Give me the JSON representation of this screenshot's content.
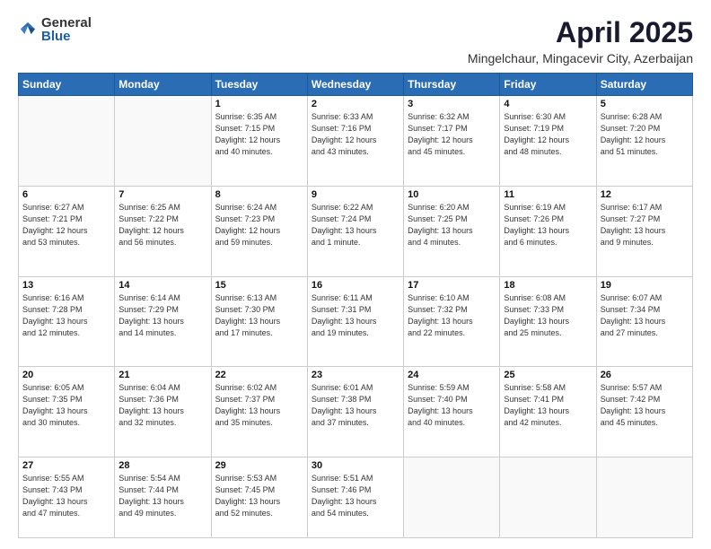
{
  "logo": {
    "general": "General",
    "blue": "Blue"
  },
  "header": {
    "month": "April 2025",
    "location": "Mingelchaur, Mingacevir City, Azerbaijan"
  },
  "days_of_week": [
    "Sunday",
    "Monday",
    "Tuesday",
    "Wednesday",
    "Thursday",
    "Friday",
    "Saturday"
  ],
  "weeks": [
    [
      {
        "day": "",
        "info": ""
      },
      {
        "day": "",
        "info": ""
      },
      {
        "day": "1",
        "info": "Sunrise: 6:35 AM\nSunset: 7:15 PM\nDaylight: 12 hours\nand 40 minutes."
      },
      {
        "day": "2",
        "info": "Sunrise: 6:33 AM\nSunset: 7:16 PM\nDaylight: 12 hours\nand 43 minutes."
      },
      {
        "day": "3",
        "info": "Sunrise: 6:32 AM\nSunset: 7:17 PM\nDaylight: 12 hours\nand 45 minutes."
      },
      {
        "day": "4",
        "info": "Sunrise: 6:30 AM\nSunset: 7:19 PM\nDaylight: 12 hours\nand 48 minutes."
      },
      {
        "day": "5",
        "info": "Sunrise: 6:28 AM\nSunset: 7:20 PM\nDaylight: 12 hours\nand 51 minutes."
      }
    ],
    [
      {
        "day": "6",
        "info": "Sunrise: 6:27 AM\nSunset: 7:21 PM\nDaylight: 12 hours\nand 53 minutes."
      },
      {
        "day": "7",
        "info": "Sunrise: 6:25 AM\nSunset: 7:22 PM\nDaylight: 12 hours\nand 56 minutes."
      },
      {
        "day": "8",
        "info": "Sunrise: 6:24 AM\nSunset: 7:23 PM\nDaylight: 12 hours\nand 59 minutes."
      },
      {
        "day": "9",
        "info": "Sunrise: 6:22 AM\nSunset: 7:24 PM\nDaylight: 13 hours\nand 1 minute."
      },
      {
        "day": "10",
        "info": "Sunrise: 6:20 AM\nSunset: 7:25 PM\nDaylight: 13 hours\nand 4 minutes."
      },
      {
        "day": "11",
        "info": "Sunrise: 6:19 AM\nSunset: 7:26 PM\nDaylight: 13 hours\nand 6 minutes."
      },
      {
        "day": "12",
        "info": "Sunrise: 6:17 AM\nSunset: 7:27 PM\nDaylight: 13 hours\nand 9 minutes."
      }
    ],
    [
      {
        "day": "13",
        "info": "Sunrise: 6:16 AM\nSunset: 7:28 PM\nDaylight: 13 hours\nand 12 minutes."
      },
      {
        "day": "14",
        "info": "Sunrise: 6:14 AM\nSunset: 7:29 PM\nDaylight: 13 hours\nand 14 minutes."
      },
      {
        "day": "15",
        "info": "Sunrise: 6:13 AM\nSunset: 7:30 PM\nDaylight: 13 hours\nand 17 minutes."
      },
      {
        "day": "16",
        "info": "Sunrise: 6:11 AM\nSunset: 7:31 PM\nDaylight: 13 hours\nand 19 minutes."
      },
      {
        "day": "17",
        "info": "Sunrise: 6:10 AM\nSunset: 7:32 PM\nDaylight: 13 hours\nand 22 minutes."
      },
      {
        "day": "18",
        "info": "Sunrise: 6:08 AM\nSunset: 7:33 PM\nDaylight: 13 hours\nand 25 minutes."
      },
      {
        "day": "19",
        "info": "Sunrise: 6:07 AM\nSunset: 7:34 PM\nDaylight: 13 hours\nand 27 minutes."
      }
    ],
    [
      {
        "day": "20",
        "info": "Sunrise: 6:05 AM\nSunset: 7:35 PM\nDaylight: 13 hours\nand 30 minutes."
      },
      {
        "day": "21",
        "info": "Sunrise: 6:04 AM\nSunset: 7:36 PM\nDaylight: 13 hours\nand 32 minutes."
      },
      {
        "day": "22",
        "info": "Sunrise: 6:02 AM\nSunset: 7:37 PM\nDaylight: 13 hours\nand 35 minutes."
      },
      {
        "day": "23",
        "info": "Sunrise: 6:01 AM\nSunset: 7:38 PM\nDaylight: 13 hours\nand 37 minutes."
      },
      {
        "day": "24",
        "info": "Sunrise: 5:59 AM\nSunset: 7:40 PM\nDaylight: 13 hours\nand 40 minutes."
      },
      {
        "day": "25",
        "info": "Sunrise: 5:58 AM\nSunset: 7:41 PM\nDaylight: 13 hours\nand 42 minutes."
      },
      {
        "day": "26",
        "info": "Sunrise: 5:57 AM\nSunset: 7:42 PM\nDaylight: 13 hours\nand 45 minutes."
      }
    ],
    [
      {
        "day": "27",
        "info": "Sunrise: 5:55 AM\nSunset: 7:43 PM\nDaylight: 13 hours\nand 47 minutes."
      },
      {
        "day": "28",
        "info": "Sunrise: 5:54 AM\nSunset: 7:44 PM\nDaylight: 13 hours\nand 49 minutes."
      },
      {
        "day": "29",
        "info": "Sunrise: 5:53 AM\nSunset: 7:45 PM\nDaylight: 13 hours\nand 52 minutes."
      },
      {
        "day": "30",
        "info": "Sunrise: 5:51 AM\nSunset: 7:46 PM\nDaylight: 13 hours\nand 54 minutes."
      },
      {
        "day": "",
        "info": ""
      },
      {
        "day": "",
        "info": ""
      },
      {
        "day": "",
        "info": ""
      }
    ]
  ]
}
